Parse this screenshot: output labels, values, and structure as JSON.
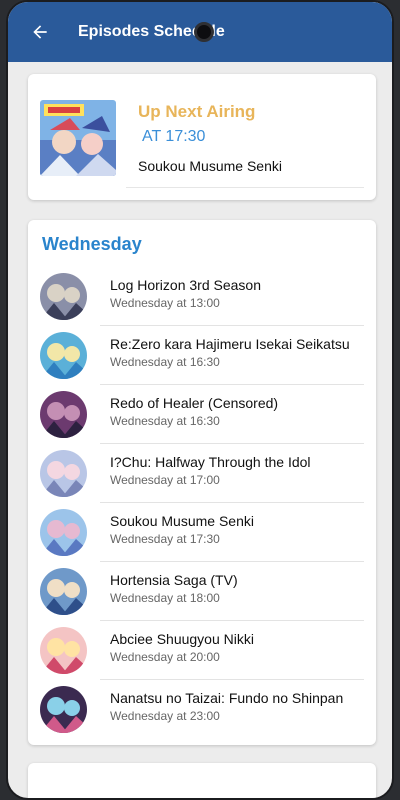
{
  "appbar": {
    "title": "Episodes Schedule",
    "back_icon": "arrow-left-icon",
    "color": "#2a5a9a"
  },
  "up_next": {
    "heading": "Up Next Airing",
    "time": "AT 17:30",
    "show": "Soukou Musume Senki",
    "heading_color": "#e8b55a",
    "time_color": "#3b8fd8"
  },
  "day": {
    "title": "Wednesday",
    "title_color": "#2a84cc",
    "episodes": [
      {
        "title": " Log Horizon 3rd Season",
        "time": "Wednesday at 13:00"
      },
      {
        "title": "Re:Zero kara Hajimeru Isekai Seikatsu",
        "time": "Wednesday at 16:30"
      },
      {
        "title": "Redo of Healer (Censored)",
        "time": "Wednesday at 16:30"
      },
      {
        "title": "I?Chu: Halfway Through the Idol",
        "time": "Wednesday at 17:00"
      },
      {
        "title": "Soukou Musume Senki",
        "time": "Wednesday at 17:30"
      },
      {
        "title": "Hortensia Saga (TV)",
        "time": "Wednesday at 18:00"
      },
      {
        "title": "Abciee Shuugyou Nikki",
        "time": "Wednesday at 20:00"
      },
      {
        "title": "Nanatsu no Taizai: Fundo no Shinpan",
        "time": "Wednesday at 23:00"
      }
    ]
  }
}
